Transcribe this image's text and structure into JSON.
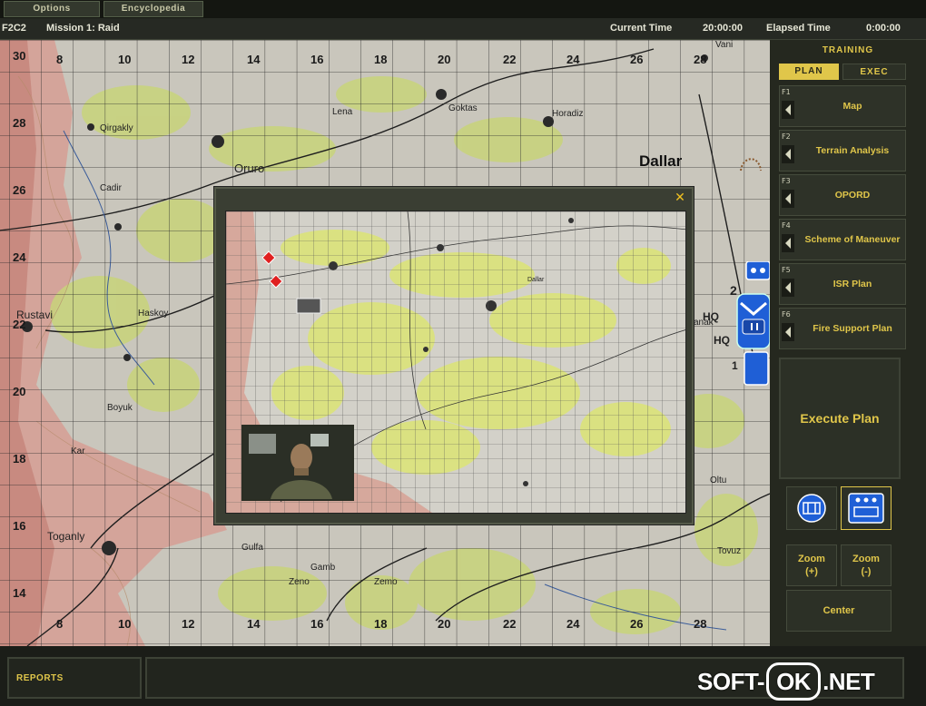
{
  "menu": {
    "options": "Options",
    "encyclopedia": "Encyclopedia"
  },
  "status": {
    "unit": "F2C2",
    "mission": "Mission 1: Raid",
    "current_time_label": "Current Time",
    "current_time": "20:00:00",
    "elapsed_time_label": "Elapsed Time",
    "elapsed_time": "0:00:00"
  },
  "map": {
    "top_labels": [
      "8",
      "10",
      "12",
      "14",
      "16",
      "18",
      "20",
      "22",
      "24",
      "26",
      "28"
    ],
    "bottom_labels": [
      "8",
      "10",
      "12",
      "14",
      "16",
      "18",
      "20",
      "22",
      "24",
      "26",
      "28"
    ],
    "left_labels": [
      "30",
      "28",
      "26",
      "24",
      "22",
      "20",
      "18",
      "16",
      "14"
    ],
    "towns": {
      "oruro": "Oruro",
      "dallar": "Dallar",
      "rustavi": "Rustavi",
      "toganly": "Toganly",
      "haskoy": "Haskoy",
      "boyuk": "Boyuk",
      "kar": "Kar",
      "goktas": "Goktas",
      "horadiz": "Horadiz",
      "lena": "Lena",
      "qirgakly": "Qirgakly",
      "cadir": "Cadir",
      "oltu": "Oltu",
      "tovuz": "Tovuz",
      "gamb": "Gamb",
      "zeno": "Zeno",
      "zemo": "Zemo",
      "gulfa": "Gulfa",
      "vani": "Vani",
      "anak": "anak"
    },
    "unit_labels": {
      "hq1": "HQ",
      "hq2": "HQ",
      "num2": "2",
      "num1": "1"
    }
  },
  "popup": {
    "close": "✕",
    "minimap_label": "Dallar"
  },
  "panel": {
    "title": "TRAINING",
    "tab_plan": "PLAN",
    "tab_exec": "EXEC",
    "fbuttons": [
      {
        "key": "F1",
        "label": "Map"
      },
      {
        "key": "F2",
        "label": "Terrain Analysis"
      },
      {
        "key": "F3",
        "label": "OPORD"
      },
      {
        "key": "F4",
        "label": "Scheme of Maneuver"
      },
      {
        "key": "F5",
        "label": "ISR Plan"
      },
      {
        "key": "F6",
        "label": "Fire Support Plan"
      }
    ],
    "execute": "Execute Plan",
    "zoom_in": "Zoom\n(+)",
    "zoom_out": "Zoom\n(-)",
    "center": "Center"
  },
  "bottom": {
    "reports": "REPORTS"
  },
  "watermark": {
    "pre": "SOFT-",
    "ok": "OK",
    "post": ".NET"
  },
  "colors": {
    "accent": "#e0c64a",
    "unit_blue": "#1f5fd6",
    "enemy_red": "#e02020"
  }
}
